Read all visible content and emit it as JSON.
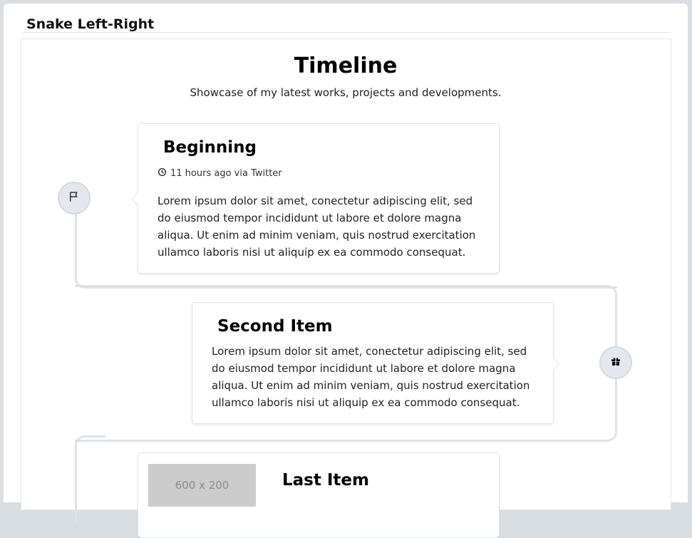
{
  "page": {
    "title": "Snake Left-Right"
  },
  "timeline": {
    "heading": "Timeline",
    "subtitle": "Showcase of my latest works, projects and developments.",
    "items": [
      {
        "title": "Beginning",
        "meta": "11 hours ago via Twitter",
        "icon": "flag-icon",
        "body": "Lorem ipsum dolor sit amet, conectetur adipiscing elit, sed do eiusmod tempor incididunt ut labore et dolore magna aliqua. Ut enim ad minim veniam, quis nostrud exercitation ullamco laboris nisi ut aliquip ex ea commodo consequat."
      },
      {
        "title": "Second Item",
        "icon": "gift-icon",
        "body": "Lorem ipsum dolor sit amet, conectetur adipiscing elit, sed do eiusmod tempor incididunt ut labore et dolore magna aliqua. Ut enim ad minim veniam, quis nostrud exercitation ullamco laboris nisi ut aliquip ex ea commodo consequat."
      },
      {
        "title": "Last Item",
        "image_label": "600 x 200"
      }
    ]
  },
  "colors": {
    "line": "#dde2e8",
    "marker_bg": "#e4e8ee",
    "placeholder": "#cccccc"
  }
}
